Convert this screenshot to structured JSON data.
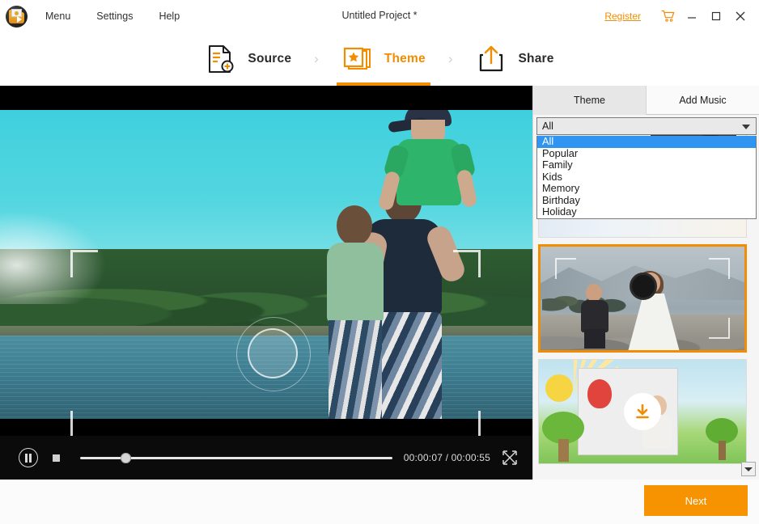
{
  "titlebar": {
    "logo_icon": "app-logo-icon",
    "menus": [
      {
        "label": "Menu"
      },
      {
        "label": "Settings"
      },
      {
        "label": "Help"
      }
    ],
    "project_title": "Untitled Project *",
    "register_label": "Register",
    "cart_icon": "shopping-cart-icon",
    "minimize_icon": "minimize-icon",
    "maximize_icon": "maximize-icon",
    "close_icon": "close-icon"
  },
  "steps": [
    {
      "label": "Source",
      "icon": "document-add-icon",
      "active": false
    },
    {
      "label": "Theme",
      "icon": "theme-stack-star-icon",
      "active": true
    },
    {
      "label": "Share",
      "icon": "share-upload-icon",
      "active": false
    }
  ],
  "step_separator": "›",
  "player": {
    "pause_icon": "pause-icon",
    "stop_icon": "stop-icon",
    "current_time": "00:00:07",
    "total_time": "00:00:55",
    "timecode": "00:00:07 / 00:00:55",
    "progress_percent": 13,
    "fullscreen_icon": "fullscreen-icon",
    "overlay_icon": "camera-lens-overlay"
  },
  "panel": {
    "tabs": [
      {
        "label": "Theme",
        "active": true
      },
      {
        "label": "Add Music",
        "active": false
      }
    ],
    "category_select": {
      "value": "All",
      "arrow_icon": "chevron-down-icon",
      "expanded": true,
      "options": [
        {
          "label": "All",
          "selected": true
        },
        {
          "label": "Popular",
          "selected": false
        },
        {
          "label": "Family",
          "selected": false
        },
        {
          "label": "Kids",
          "selected": false
        },
        {
          "label": "Memory",
          "selected": false
        },
        {
          "label": "Birthday",
          "selected": false
        },
        {
          "label": "Holiday",
          "selected": false
        }
      ]
    },
    "themes": [
      {
        "name": "theme-thumbnail-1",
        "selected": false,
        "downloadable": false
      },
      {
        "name": "theme-thumbnail-2-wedding",
        "selected": true,
        "downloadable": false
      },
      {
        "name": "theme-thumbnail-3-kids",
        "selected": false,
        "downloadable": true,
        "download_icon": "download-icon"
      }
    ],
    "scroll_down_icon": "scroll-down-arrow-icon"
  },
  "footer": {
    "next_label": "Next"
  },
  "colors": {
    "accent": "#f28c00",
    "next_button": "#f79200",
    "highlight": "#2f95f0",
    "panel_bg": "#f5f5f5",
    "preview_bg": "#000000"
  }
}
